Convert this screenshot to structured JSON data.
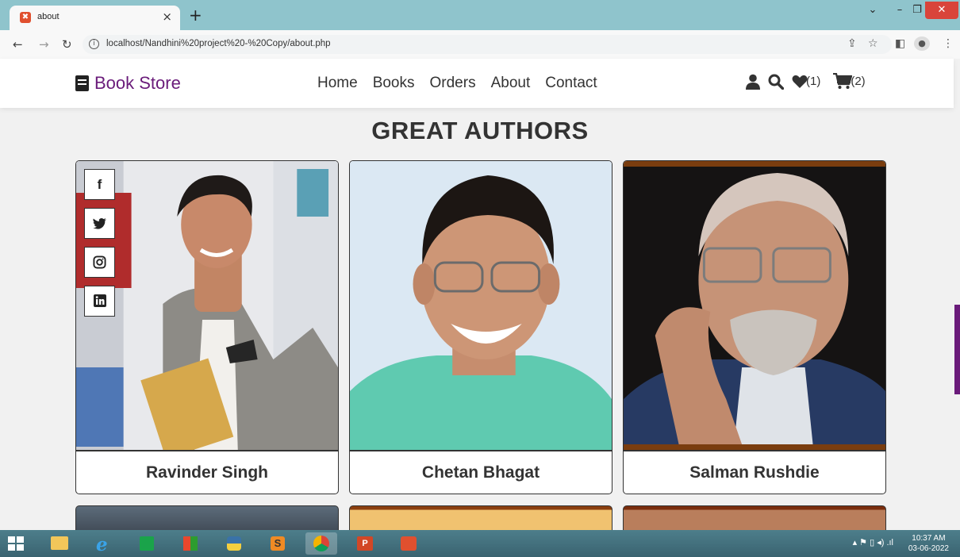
{
  "browser": {
    "tab_title": "about",
    "tab_favicon": "xampp-icon",
    "new_tab_label": "+",
    "url": "localhost/Nandhini%20project%20-%20Copy/about.php"
  },
  "site": {
    "logo_text": "Book Store",
    "nav": [
      "Home",
      "Books",
      "Orders",
      "About",
      "Contact"
    ],
    "wishlist_count": "(1)",
    "cart_count": "(2)",
    "accent_color": "#6a1b7a"
  },
  "main": {
    "heading": "GREAT AUTHORS",
    "authors": [
      {
        "name": "Ravinder Singh"
      },
      {
        "name": "Chetan Bhagat"
      },
      {
        "name": "Salman Rushdie"
      }
    ],
    "share_icons": [
      "facebook-icon",
      "twitter-icon",
      "instagram-icon",
      "linkedin-icon"
    ]
  },
  "taskbar": {
    "time": "10:37 AM",
    "date": "03-06-2022"
  }
}
